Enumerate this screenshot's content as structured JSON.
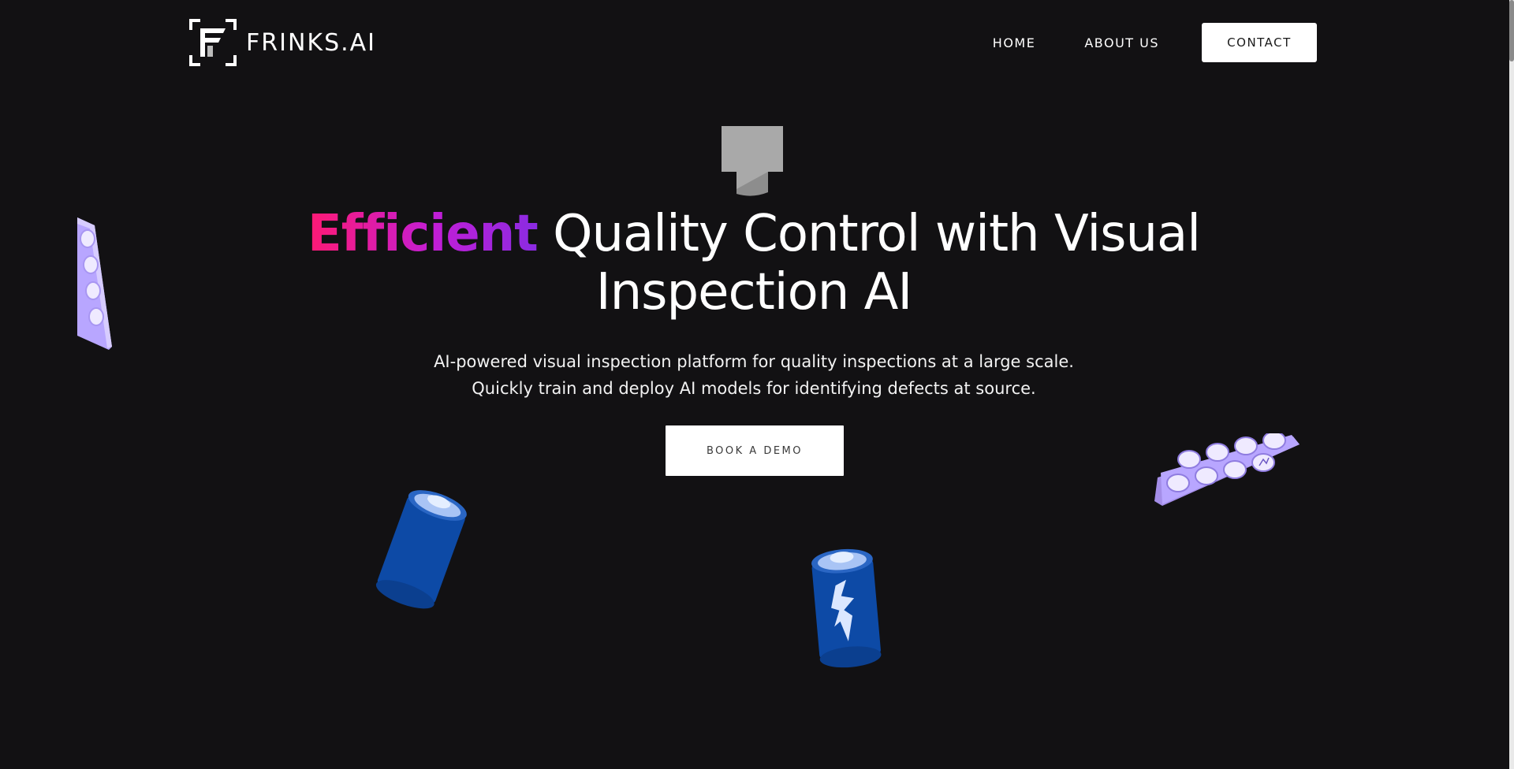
{
  "header": {
    "logo_text": "FRINKS.AI",
    "logo_icon": "frinks-logo-icon",
    "nav": {
      "home_label": "HOME",
      "about_label": "ABOUT US",
      "contact_label": "CONTACT"
    }
  },
  "hero": {
    "icon": "camera-icon",
    "title_accent": "Efficient",
    "title_rest": " Quality Control with Visual Inspection AI",
    "subtitle_line1": "AI-powered visual inspection platform for quality inspections at a large scale.",
    "subtitle_line2": "Quickly train and deploy AI models for identifying defects at source.",
    "cta_label": "BOOK A DEMO"
  },
  "decorations": [
    "pill-blister-icon",
    "battery-icon",
    "defective-battery-icon",
    "defective-pill-blister-icon"
  ],
  "colors": {
    "background": "#121113",
    "accent_start": "#ff1a73",
    "accent_end": "#8a2be2",
    "battery_blue": "#0d4aa6",
    "pill_lavender": "#b8a6ff"
  }
}
